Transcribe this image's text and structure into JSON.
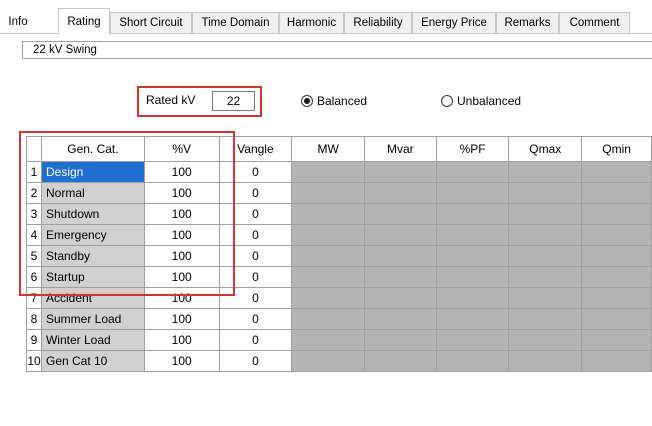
{
  "tabs": [
    {
      "label": "Info"
    },
    {
      "label": "Rating",
      "active": true
    },
    {
      "label": "Short Circuit"
    },
    {
      "label": "Time Domain"
    },
    {
      "label": "Harmonic"
    },
    {
      "label": "Reliability"
    },
    {
      "label": "Energy Price"
    },
    {
      "label": "Remarks"
    },
    {
      "label": "Comment"
    }
  ],
  "panel": {
    "title": "22 kV  Swing"
  },
  "rating": {
    "rated_kv_label": "Rated kV",
    "rated_kv_value": "22",
    "balanced_label": "Balanced",
    "unbalanced_label": "Unbalanced",
    "balanced_selected": true
  },
  "grid": {
    "columns": [
      "",
      "Gen. Cat.",
      "%V",
      "Vangle",
      "MW",
      "Mvar",
      "%PF",
      "Qmax",
      "Qmin"
    ],
    "rows": [
      {
        "idx": "1",
        "cat": "Design",
        "v": "100",
        "angle": "0",
        "selected": true
      },
      {
        "idx": "2",
        "cat": "Normal",
        "v": "100",
        "angle": "0"
      },
      {
        "idx": "3",
        "cat": "Shutdown",
        "v": "100",
        "angle": "0"
      },
      {
        "idx": "4",
        "cat": "Emergency",
        "v": "100",
        "angle": "0"
      },
      {
        "idx": "5",
        "cat": "Standby",
        "v": "100",
        "angle": "0"
      },
      {
        "idx": "6",
        "cat": "Startup",
        "v": "100",
        "angle": "0"
      },
      {
        "idx": "7",
        "cat": "Accident",
        "v": "100",
        "angle": "0"
      },
      {
        "idx": "8",
        "cat": "Summer Load",
        "v": "100",
        "angle": "0"
      },
      {
        "idx": "9",
        "cat": "Winter Load",
        "v": "100",
        "angle": "0"
      },
      {
        "idx": "10",
        "cat": "Gen Cat 10",
        "v": "100",
        "angle": "0"
      }
    ]
  },
  "colors": {
    "highlight": "#d9342b",
    "selection": "#1e6fd0",
    "disabled_cell": "#b4b4b4",
    "category_cell": "#d0d0d0"
  }
}
